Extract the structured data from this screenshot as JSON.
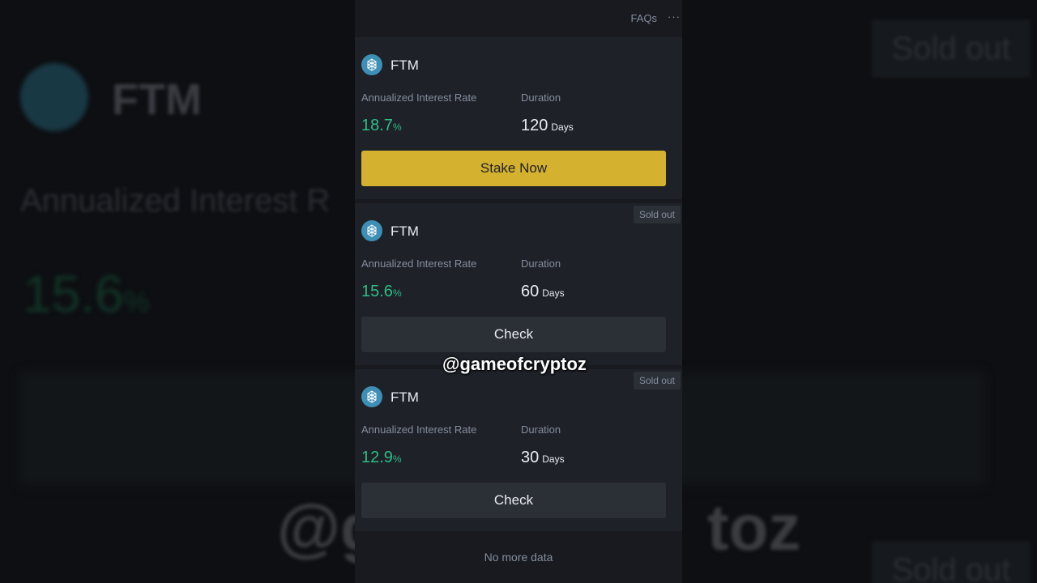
{
  "background": {
    "coin": "FTM",
    "rate_label": "Annualized Interest R",
    "rate": "15.6",
    "rate_unit": "%",
    "sold_out": "Sold out",
    "watermark_partial_left": "@g",
    "watermark_partial_right": "toz"
  },
  "header": {
    "faqs_label": "FAQs",
    "more_label": "···"
  },
  "products": [
    {
      "coin": "FTM",
      "rate_label": "Annualized Interest Rate",
      "rate": "18.7",
      "rate_unit": "%",
      "duration_label": "Duration",
      "duration": "120",
      "duration_unit": "Days",
      "button_label": "Stake Now",
      "sold_out": null
    },
    {
      "coin": "FTM",
      "rate_label": "Annualized Interest Rate",
      "rate": "15.6",
      "rate_unit": "%",
      "duration_label": "Duration",
      "duration": "60",
      "duration_unit": "Days",
      "button_label": "Check",
      "sold_out": "Sold out"
    },
    {
      "coin": "FTM",
      "rate_label": "Annualized Interest Rate",
      "rate": "12.9",
      "rate_unit": "%",
      "duration_label": "Duration",
      "duration": "30",
      "duration_unit": "Days",
      "button_label": "Check",
      "sold_out": "Sold out"
    }
  ],
  "watermark": "@gameofcryptoz",
  "footer": {
    "no_more": "No more data"
  },
  "colors": {
    "accent": "#d4b12f",
    "positive": "#2ebd85",
    "coin_icon": "#3e8fb5"
  },
  "icons": {
    "coin": "ftm-coin-icon",
    "more": "more-dots-icon"
  }
}
